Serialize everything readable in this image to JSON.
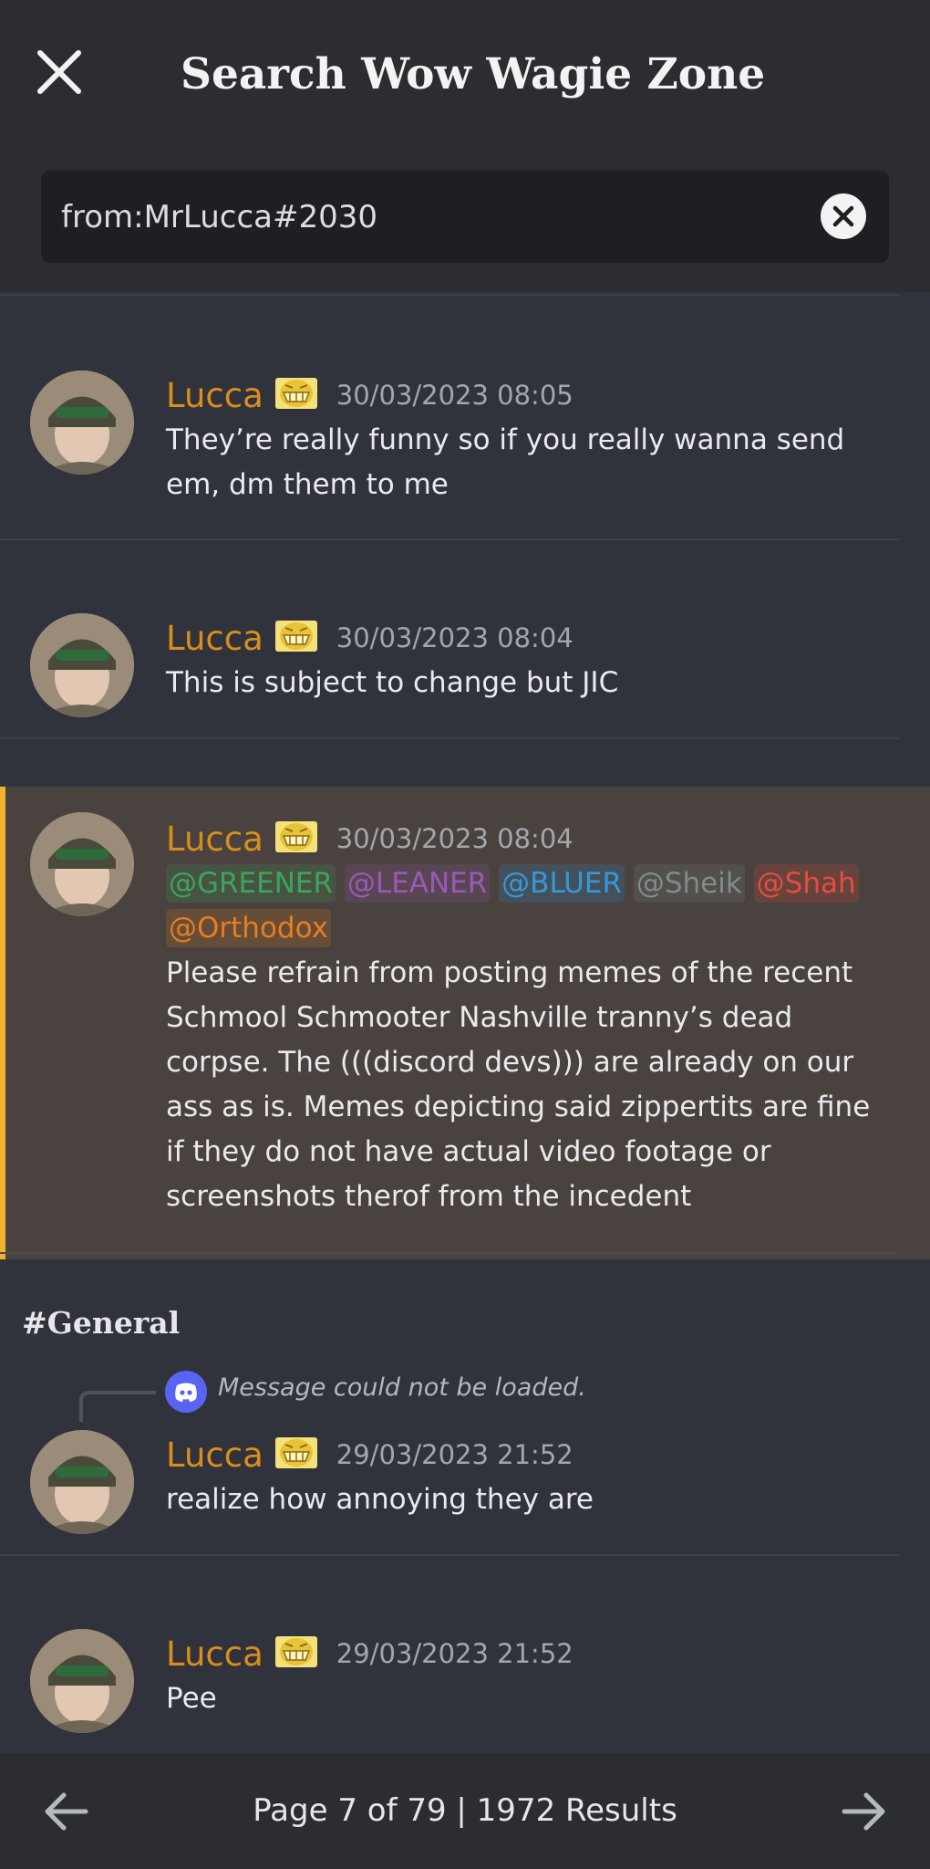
{
  "header": {
    "title": "Search Wow Wagie Zone",
    "close_icon": "close-icon"
  },
  "search": {
    "query": "from:MrLucca#2030",
    "clear_icon": "clear-icon"
  },
  "messages": [
    {
      "author": "Lucca",
      "author_color": "#d98e1b",
      "badge_icon": "cheering-emote-icon",
      "timestamp": "30/03/2023 08:05",
      "text": "They’re really funny so if you really wanna send em, dm them to me"
    },
    {
      "author": "Lucca",
      "author_color": "#d98e1b",
      "badge_icon": "cheering-emote-icon",
      "timestamp": "30/03/2023 08:04",
      "text": "This is subject to change but JIC"
    },
    {
      "author": "Lucca",
      "author_color": "#d98e1b",
      "badge_icon": "cheering-emote-icon",
      "timestamp": "30/03/2023 08:04",
      "highlighted": true,
      "mentions": [
        {
          "label": "@GREENER",
          "color": "#3ba55c"
        },
        {
          "label": "@LEANER",
          "color": "#9b59b6"
        },
        {
          "label": "@BLUER",
          "color": "#3498db"
        },
        {
          "label": "@Sheik",
          "color": "#7f8c8d"
        },
        {
          "label": "@Shah",
          "color": "#e74c3c"
        },
        {
          "label": "@Orthodox",
          "color": "#e67e22"
        }
      ],
      "text": "Please refrain from posting memes of the recent Schmool Schmooter Nashville tranny’s dead corpse. The (((discord devs))) are already on our ass as is. Memes depicting said zippertits are fine if they do not have actual video footage or screenshots therof from the incedent"
    },
    {
      "author": "Lucca",
      "author_color": "#d98e1b",
      "badge_icon": "cheering-emote-icon",
      "timestamp": "29/03/2023 21:52",
      "text": "realize how annoying they are"
    },
    {
      "author": "Lucca",
      "author_color": "#d98e1b",
      "badge_icon": "cheering-emote-icon",
      "timestamp": "29/03/2023 21:52",
      "text": "Pee"
    }
  ],
  "channel": {
    "label": "#General"
  },
  "reply": {
    "icon": "discord-icon",
    "text": "Message could not be loaded."
  },
  "footer": {
    "page_info": "Page 7 of 79  |  1972 Results",
    "prev_icon": "arrow-left-icon",
    "next_icon": "arrow-right-icon"
  },
  "colors": {
    "background": "#31333c",
    "header": "#2b2d31",
    "highlight": "#4a423e",
    "highlight_accent": "#f0b232"
  }
}
